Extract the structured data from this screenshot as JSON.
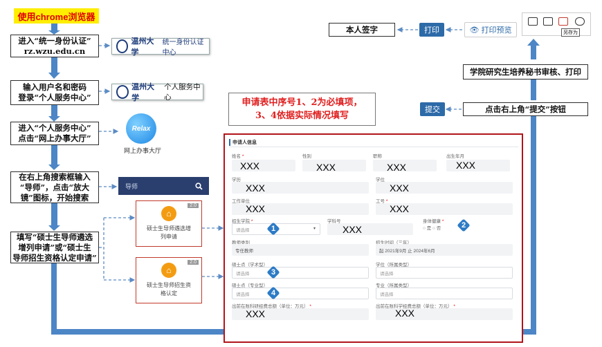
{
  "title": "使用chrome浏览器",
  "steps": {
    "s1": {
      "l1": "进入“统一身份认证”",
      "l2": "rz.wzu.edu.cn"
    },
    "s2": {
      "l1": "输入用户名和密码",
      "l2": "登录“个人服务中心”"
    },
    "s3": {
      "l1": "进入“个人服务中心”",
      "l2": "点击“网上办事大厅”"
    },
    "s4": {
      "l1": "在右上角搜索框输入",
      "l2": "“导师”，点击“放大",
      "l3": "镜”图标，开始搜索"
    },
    "s5": {
      "l1": "填写“硕士生导师遴选",
      "l2": "增列申请”或“硕士生",
      "l3": "导师招生资格认定申请”"
    },
    "click_submit": "点击右上角“提交”按钮",
    "review": "学院研究生培养秘书审核、打印",
    "sign": "本人签字"
  },
  "logos": {
    "univ_name": "温州大学",
    "auth_center": "统一身份认证中心",
    "personal_center": "个人服务中心",
    "relax": "Relax",
    "hall": "网上办事大厅"
  },
  "search": {
    "value": "导师"
  },
  "cards": {
    "card1": {
      "badge": "2.0",
      "l1": "硕士生导师遴选增",
      "l2": "列申请"
    },
    "card2": {
      "badge": "2.0",
      "l1": "硕士生导师招生资",
      "l2": "格认定"
    }
  },
  "note": {
    "l1": "申请表中序号1、2为必填项，",
    "l2": "3、4依据实际情况填写"
  },
  "buttons": {
    "submit": "提交",
    "print": "打印",
    "print_preview": "打印预览",
    "save_as": "另存为"
  },
  "form": {
    "section": "申请人信息",
    "labels": {
      "name": "姓名",
      "gender": "性别",
      "title": "职称",
      "birth": "出生年月",
      "degree": "学历",
      "degree2": "学位",
      "workplace": "工作单位",
      "work_id": "工号",
      "college": "招生学院",
      "subject_code": "学科号",
      "healthy": "身体健康",
      "tutor_type": "教师类别",
      "period": "招生时间（三年）",
      "point_academic": "硕士点（学术型）",
      "subject_type": "学位（所属类型）",
      "point_prof": "硕士点（专业型）",
      "major_type": "专业（所属类型）",
      "funds_a": "出前在账科研经费总额（单位：万元）",
      "funds_b": "出前在账科学经费总额（单位：万元）"
    },
    "values": {
      "placeholder": "XXX",
      "select": "请选择",
      "tutor_type": "专任教师",
      "period": "起  2021年9月   止  2024年6月",
      "yes": "是",
      "no": "否"
    }
  },
  "markers": {
    "m1": "1",
    "m2": "2",
    "m3": "3",
    "m4": "4"
  }
}
